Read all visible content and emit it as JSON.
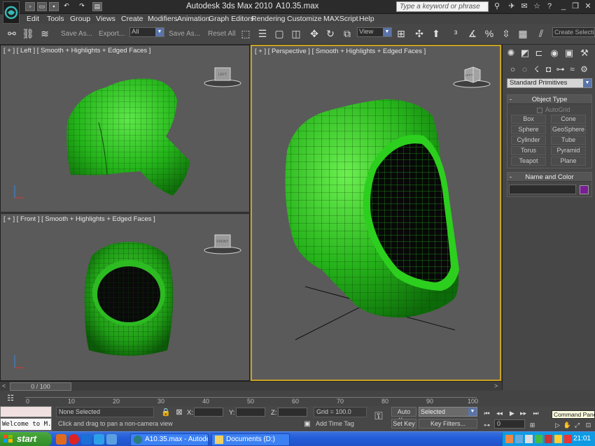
{
  "window": {
    "app_title": "Autodesk 3ds Max  2010",
    "file_title": "A10.35.max",
    "search_placeholder": "Type a keyword or phrase"
  },
  "menu": [
    "Edit",
    "Tools",
    "Group",
    "Views",
    "Create",
    "Modifiers",
    "Animation",
    "Graph Editors",
    "Rendering",
    "Customize",
    "MAXScript",
    "Help"
  ],
  "toolbar": {
    "save_as_1": "Save As...",
    "export": "Export...",
    "filter_value": "All",
    "save_as_2": "Save As...",
    "reset_all": "Reset All",
    "ref_coord_value": "View",
    "create_selection_set": "Create Selection Se"
  },
  "viewports": {
    "left": {
      "label": "[ + ] [ Left ] [ Smooth + Highlights + Edged Faces ]",
      "cube": "LEFT"
    },
    "front": {
      "label": "[ + ] [ Front ] [ Smooth + Highlights + Edged Faces ]",
      "cube": "FRONT"
    },
    "perspective": {
      "label": "[ + ] [ Perspective ] [ Smooth + Highlights + Edged Faces ]",
      "cube": "LEFT"
    }
  },
  "command_panel": {
    "category_value": "Standard Primitives",
    "object_type_title": "Object Type",
    "autogrid_label": "AutoGrid",
    "primitives": [
      "Box",
      "Cone",
      "Sphere",
      "GeoSphere",
      "Cylinder",
      "Tube",
      "Torus",
      "Pyramid",
      "Teapot",
      "Plane"
    ],
    "name_color_title": "Name and Color",
    "object_color": "#7a1d96"
  },
  "timeline": {
    "frame_range": "0 / 100",
    "ticks": [
      "0",
      "10",
      "20",
      "30",
      "40",
      "50",
      "60",
      "70",
      "80",
      "90",
      "100"
    ]
  },
  "status": {
    "welcome": "Welcome to M.",
    "selection": "None Selected",
    "prompt": "Click and drag to pan a non-camera view",
    "x_label": "X:",
    "y_label": "Y:",
    "z_label": "Z:",
    "grid": "Grid = 100.0",
    "add_time_tag": "Add Time Tag",
    "auto_key": "Auto Key",
    "set_key": "Set Key",
    "selected_value": "Selected",
    "key_filters": "Key Filters...",
    "current_frame": "0",
    "tooltip": "Command Panel"
  },
  "taskbar": {
    "start": "start",
    "tasks": [
      "A10.35.max - Autode...",
      "Documents (D:)"
    ],
    "clock": "21:01"
  }
}
